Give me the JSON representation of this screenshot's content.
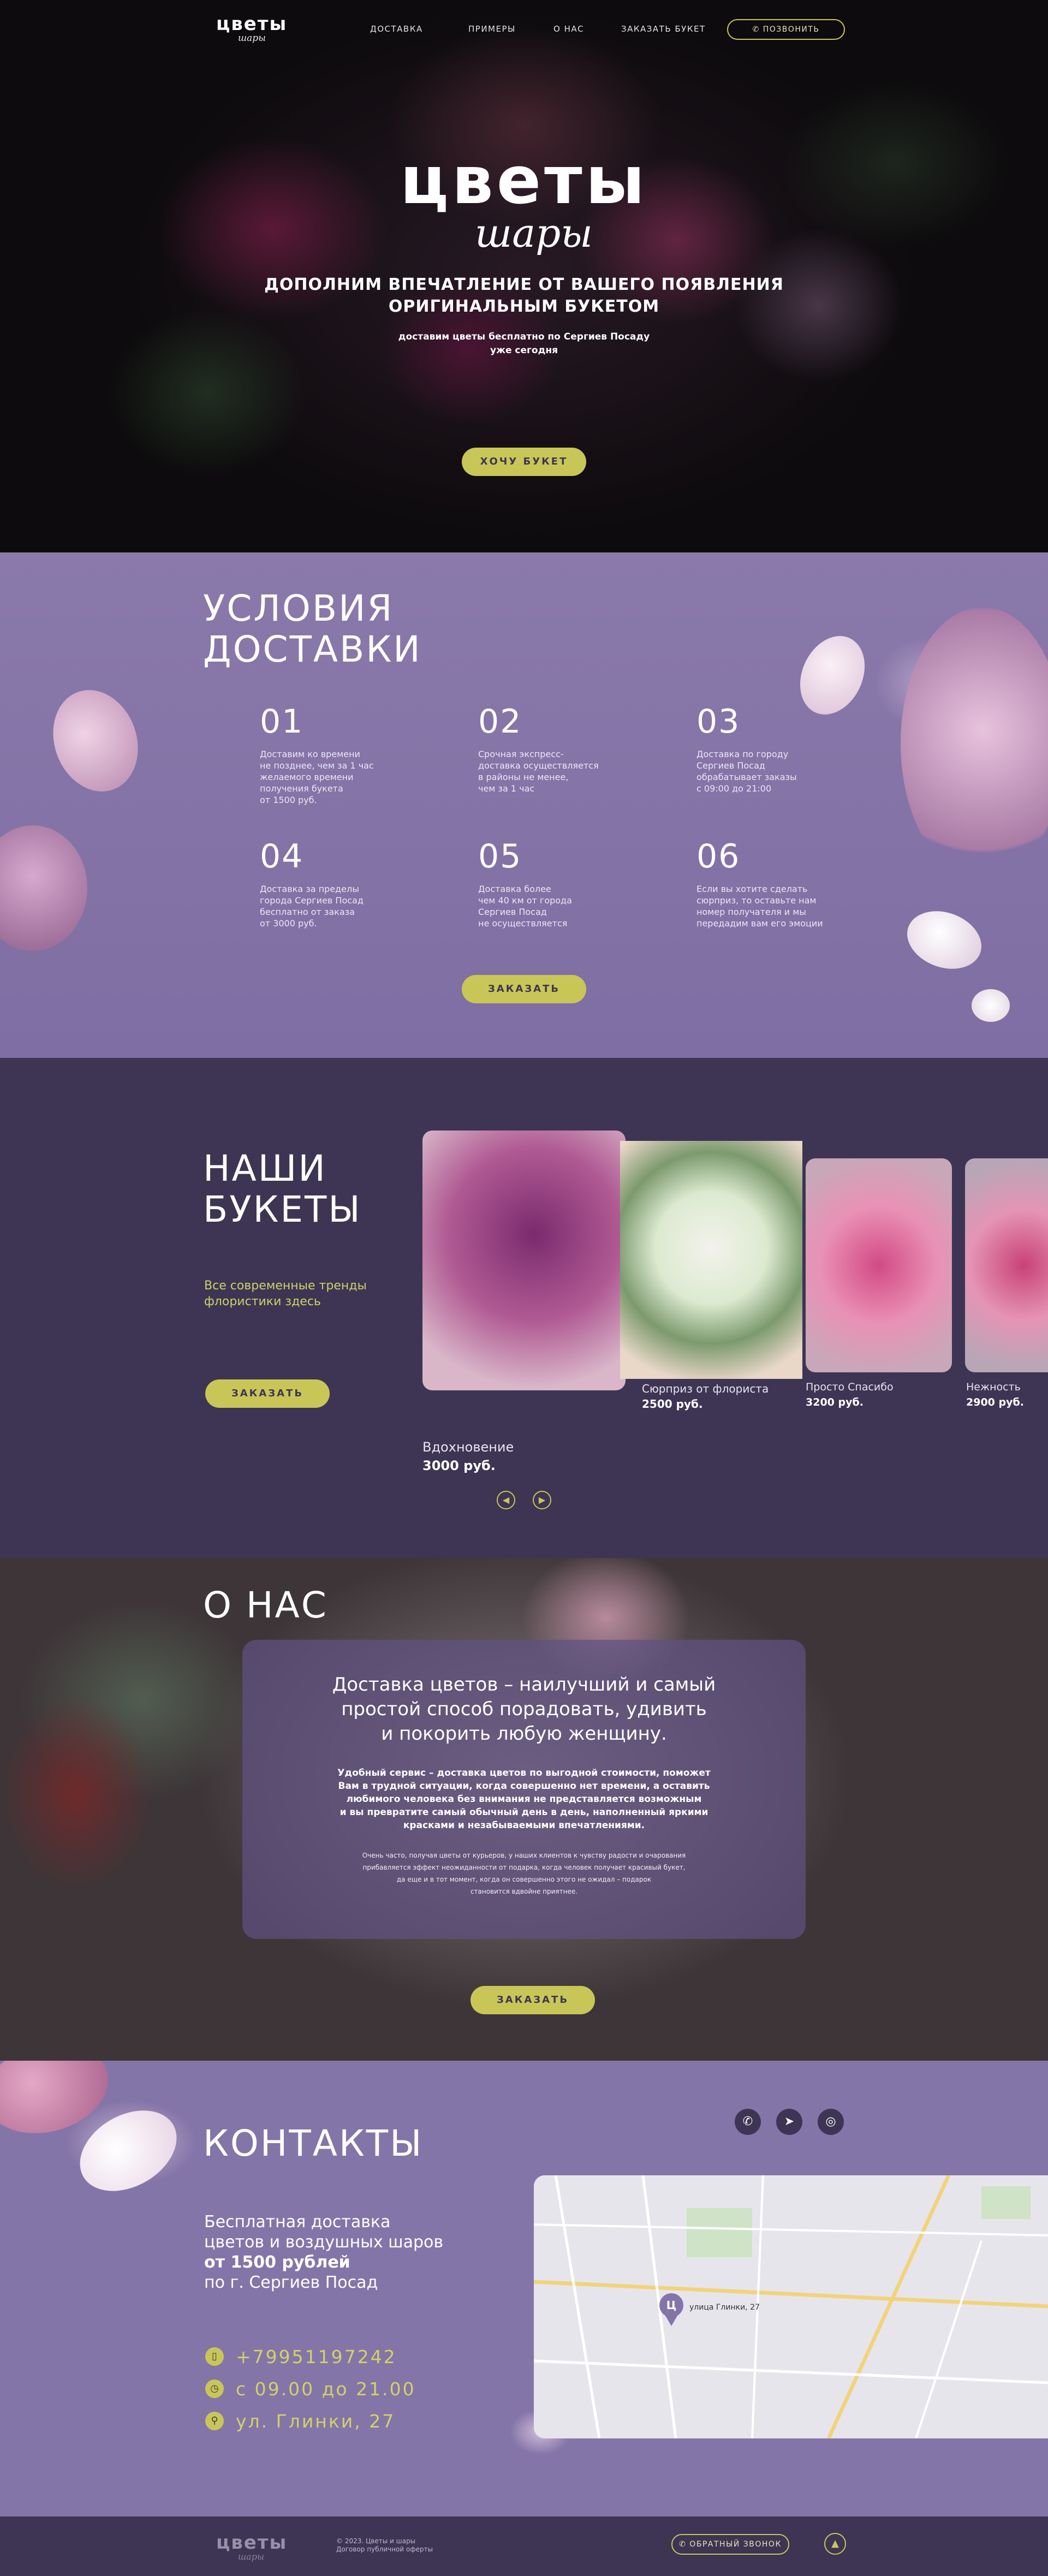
{
  "brand": {
    "word": "цветы",
    "script": "шары"
  },
  "nav": {
    "items": [
      "ДОСТАВКА",
      "ПРИМЕРЫ",
      "О НАС",
      "ЗАКАЗАТЬ БУКЕТ"
    ],
    "call_label": "ПОЗВОНИТЬ"
  },
  "hero": {
    "title": "цветы",
    "script": "шары",
    "tagline_1": "ДОПОЛНИМ ВПЕЧАТЛЕНИЕ ОТ ВАШЕГО ПОЯВЛЕНИЯ",
    "tagline_2": "ОРИГИНАЛЬНЫМ БУКЕТОМ",
    "sub_1": "доставим цветы бесплатно по Сергиев Посаду",
    "sub_2": "уже сегодня",
    "cta": "ХОЧУ БУКЕТ"
  },
  "delivery": {
    "title_1": "УСЛОВИЯ",
    "title_2": "ДОСТАВКИ",
    "conditions": [
      {
        "num": "01",
        "lines": [
          "Доставим ко времени",
          "не позднее, чем за 1 час",
          "желаемого времени",
          "получения букета",
          "от 1500 руб."
        ]
      },
      {
        "num": "02",
        "lines": [
          "Срочная экспресс-",
          "доставка осуществляется",
          "в районы не менее,",
          "чем за 1 час"
        ]
      },
      {
        "num": "03",
        "lines": [
          "Доставка по городу",
          "Сергиев Посад",
          "обрабатывает заказы",
          "с 09:00 до 21:00"
        ]
      },
      {
        "num": "04",
        "lines": [
          "Доставка за пределы",
          "города Сергиев Посад",
          "бесплатно от заказа",
          "от 3000 руб."
        ]
      },
      {
        "num": "05",
        "lines": [
          "Доставка более",
          "чем 40 км от города",
          "Сергиев Посад",
          "не осуществляется"
        ]
      },
      {
        "num": "06",
        "lines": [
          "Если вы хотите сделать",
          "сюрприз, то оставьте нам",
          "номер получателя и мы",
          "передадим вам его эмоции"
        ]
      }
    ],
    "cta": "ЗАКАЗАТЬ"
  },
  "bouquets": {
    "title_1": "НАШИ",
    "title_2": "БУКЕТЫ",
    "lead": "Все современные тренды флористики здесь",
    "cta": "ЗАКАЗАТЬ",
    "items": [
      {
        "name": "Вдохновение",
        "price": "3000 руб."
      },
      {
        "name": "Сюрприз от флориста",
        "price": "2500 руб."
      },
      {
        "name": "Просто Спасибо",
        "price": "3200 руб."
      },
      {
        "name": "Нежность",
        "price": "2900 руб."
      }
    ],
    "prev_icon": "chevron-left-icon",
    "next_icon": "chevron-right-icon"
  },
  "about": {
    "title": "О НАС",
    "heading_1": "Доставка цветов – наилучший и самый",
    "heading_2": "простой способ порадовать, удивить",
    "heading_3": "и покорить любую женщину.",
    "bold_1": "Удобный сервис – доставка цветов по выгодной стоимости, поможет",
    "bold_2": "Вам в трудной ситуации, когда совершенно нет времени, а оставить",
    "bold_3": "любимого человека без внимания не представляется возможным",
    "bold_4": "и вы превратите самый обычный день в день, наполненный яркими",
    "bold_5": "красками и незабываемыми впечатлениями.",
    "small_1": "Очень часто, получая цветы от курьеров, у наших клиентов к чувству радости и очарования",
    "small_2": "прибавляется эффект неожиданности от подарка, когда человек получает красивый букет,",
    "small_3": "да еще и в тот момент, когда он совершенно этого не ожидал – подарок",
    "small_4": "становится вдвойне приятнее.",
    "cta": "ЗАКАЗАТЬ"
  },
  "contacts": {
    "title": "КОНТАКТЫ",
    "lead_1": "Бесплатная доставка",
    "lead_2": "цветов и воздушных шаров",
    "lead_bold": "от 1500 рублей",
    "lead_3": "по г. Сергиев Посад",
    "phone": "+79951197242",
    "hours": "с 09.00 до 21.00",
    "address": "ул. Глинки, 27",
    "map_marker": "Ц",
    "map_label": "улица Глинки, 27",
    "social": [
      "whatsapp-icon",
      "telegram-icon",
      "instagram-icon"
    ]
  },
  "footer": {
    "copy_1": "© 2023. Цветы и шары",
    "copy_2": "Договор публичной оферты",
    "callback": "ОБРАТНЫЙ ЗВОНОК"
  },
  "colors": {
    "accent": "#c9c658",
    "dark": "#3d3553",
    "lavender": "#8475a8"
  }
}
